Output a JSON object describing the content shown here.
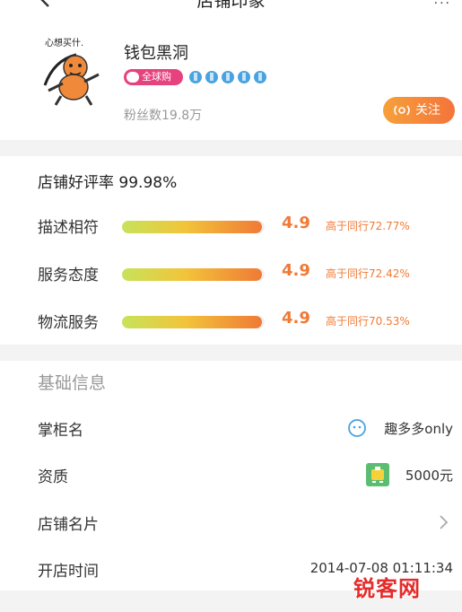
{
  "header": {
    "title": "店铺印象",
    "more": "···"
  },
  "shop": {
    "name": "钱包黑洞",
    "logo_caption": "心想买什.",
    "badge": "全球购",
    "diamond_count": 5,
    "fans": "粉丝数19.8万",
    "follow_label": "关注"
  },
  "ratings": {
    "good_rate": "店铺好评率 99.98%",
    "items": [
      {
        "label": "描述相符",
        "score": "4.9",
        "compare": "高于同行72.77%",
        "level": 0.98
      },
      {
        "label": "服务态度",
        "score": "4.9",
        "compare": "高于同行72.42%",
        "level": 0.98
      },
      {
        "label": "物流服务",
        "score": "4.9",
        "compare": "高于同行70.53%",
        "level": 0.98
      }
    ]
  },
  "basic_info": {
    "title": "基础信息",
    "seller_label": "掌柜名",
    "seller_value": "趣多多only",
    "qualification_label": "资质",
    "qualification_value": "5000元",
    "card_label": "店铺名片",
    "open_time_label": "开店时间",
    "open_time_value": "2014-07-08 01:11:34"
  },
  "watermark": {
    "text": "锐客网"
  },
  "colors": {
    "accent": "#f07a36",
    "badge": "#e6427d",
    "diamond": "#4aa3df"
  },
  "icons": [
    "back-arrow-icon",
    "more-icon",
    "diamond-icon",
    "follow-icon",
    "seller-avatar-icon",
    "certificate-icon",
    "chevron-right-icon"
  ]
}
